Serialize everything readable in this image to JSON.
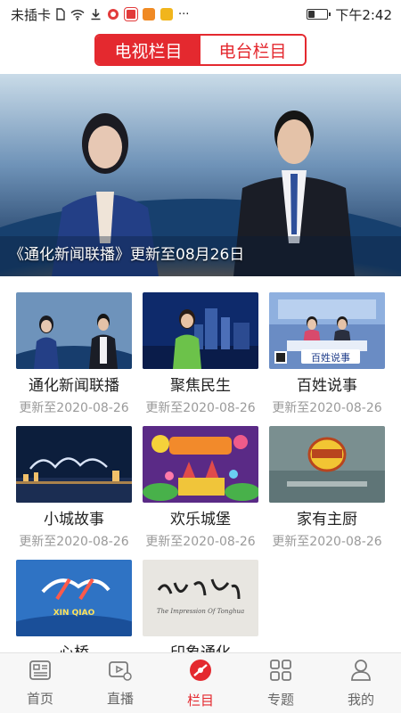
{
  "status_bar": {
    "carrier": "未插卡",
    "time": "下午2:42",
    "overflow": "···",
    "icons": [
      "sim-icon",
      "wifi-icon",
      "download-icon",
      "app-icon-red-circle",
      "app-icon-red-square",
      "app-icon-orange",
      "app-icon-yellow"
    ],
    "battery_level": 0.3
  },
  "segment": {
    "tv_label": "电视栏目",
    "radio_label": "电台栏目",
    "active": "tv",
    "accent_color": "#e4292f"
  },
  "hero": {
    "caption": "《通化新闻联播》更新至08月26日"
  },
  "programs": [
    {
      "title": "通化新闻联播",
      "updated": "更新至2020-08-26",
      "thumb": "news-anchors"
    },
    {
      "title": "聚焦民生",
      "updated": "更新至2020-08-26",
      "thumb": "reporter-city"
    },
    {
      "title": "百姓说事",
      "updated": "更新至2020-08-26",
      "thumb": "studio-talk"
    },
    {
      "title": "小城故事",
      "updated": "更新至2020-08-26",
      "thumb": "night-city"
    },
    {
      "title": "欢乐城堡",
      "updated": "更新至2020-08-26",
      "thumb": "castle-cartoon"
    },
    {
      "title": "家有主厨",
      "updated": "更新至2020-08-26",
      "thumb": "chef-logo"
    },
    {
      "title": "心桥",
      "updated": "",
      "thumb": "xinqiao-logo"
    },
    {
      "title": "印象通化",
      "updated": "",
      "thumb": "calligraphy"
    }
  ],
  "thumb_texts": {
    "studio_talk": "百姓说事",
    "xinqiao_pinyin": "XIN QIAO",
    "calligraphy_sub": "The Impression Of Tonghua"
  },
  "tabbar": {
    "items": [
      {
        "label": "首页",
        "icon": "home-news-icon"
      },
      {
        "label": "直播",
        "icon": "live-tv-icon"
      },
      {
        "label": "栏目",
        "icon": "column-disc-icon"
      },
      {
        "label": "专题",
        "icon": "topic-grid-icon"
      },
      {
        "label": "我的",
        "icon": "profile-icon"
      }
    ],
    "active_index": 2
  }
}
